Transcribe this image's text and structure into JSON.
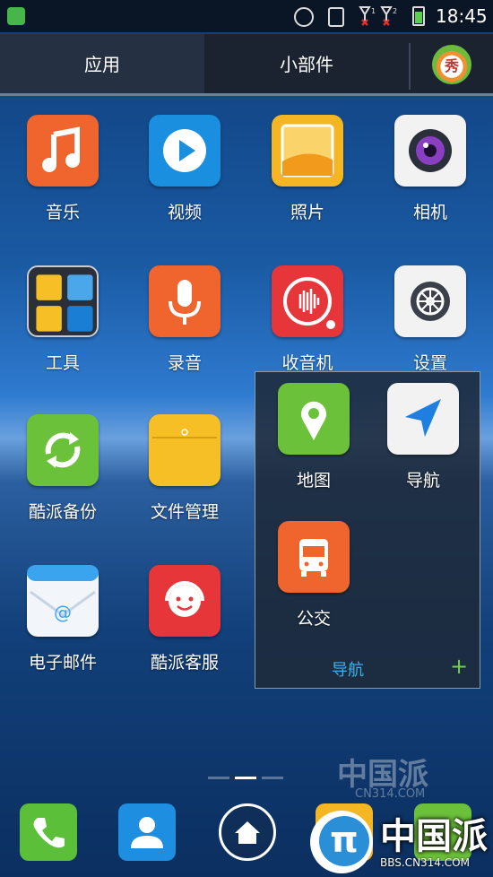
{
  "status_bar": {
    "time": "18:45",
    "icons": [
      "shield-icon",
      "alarm-icon",
      "vibrate-icon",
      "signal-1-icon",
      "signal-2-icon",
      "battery-icon"
    ],
    "signal_labels": [
      "1",
      "2"
    ]
  },
  "tabs": [
    {
      "label": "应用",
      "active": true
    },
    {
      "label": "小部件",
      "active": false
    }
  ],
  "theme_button": {
    "glyph": "秀",
    "icon": "theme-logo-icon"
  },
  "apps": [
    {
      "label": "音乐",
      "icon": "music-icon",
      "color": "#f0642d"
    },
    {
      "label": "视频",
      "icon": "video-play-icon",
      "color": "#1a8fe0"
    },
    {
      "label": "照片",
      "icon": "photo-icon",
      "color": "#f5b623"
    },
    {
      "label": "相机",
      "icon": "camera-icon",
      "color": "#f2f2f2"
    },
    {
      "label": "工具",
      "icon": "tools-icon",
      "color": "#2b2f3a"
    },
    {
      "label": "录音",
      "icon": "microphone-icon",
      "color": "#f0642d"
    },
    {
      "label": "收音机",
      "icon": "radio-icon",
      "color": "#e6363a"
    },
    {
      "label": "设置",
      "icon": "settings-gear-icon",
      "color": "#f2f2f2"
    },
    {
      "label": "酷派备份",
      "icon": "backup-sync-icon",
      "color": "#6cc13a"
    },
    {
      "label": "文件管理",
      "icon": "folder-icon",
      "color": "#f6bf25"
    },
    {
      "label": "电子邮件",
      "icon": "email-icon",
      "color": "#f2f5fa"
    },
    {
      "label": "酷派客服",
      "icon": "customer-service-icon",
      "color": "#e6363a"
    }
  ],
  "folder": {
    "name": "导航",
    "add_glyph": "+",
    "apps": [
      {
        "label": "地图",
        "icon": "map-pin-icon",
        "color": "#6cc13a"
      },
      {
        "label": "导航",
        "icon": "navigation-arrow-icon",
        "color": "#f2f2f2"
      },
      {
        "label": "公交",
        "icon": "bus-icon",
        "color": "#f0642d"
      }
    ]
  },
  "dock": [
    {
      "name": "phone",
      "icon": "phone-icon",
      "color": "#5bbf3a"
    },
    {
      "name": "contacts",
      "icon": "contacts-icon",
      "color": "#1e8fe0"
    },
    {
      "name": "home",
      "icon": "home-icon",
      "color": "#ffffff"
    },
    {
      "name": "gallery",
      "icon": "gallery-icon",
      "color": "#f5b623"
    },
    {
      "name": "apps",
      "icon": "apps-grid-icon",
      "color": "#6cc13a"
    }
  ],
  "page_indicator": {
    "pages": 3,
    "current": 2
  },
  "watermark": {
    "text": "中国派",
    "url_small": "CN314.COM",
    "url_big": "BBS.CN314.COM",
    "logo_glyph": "π"
  }
}
